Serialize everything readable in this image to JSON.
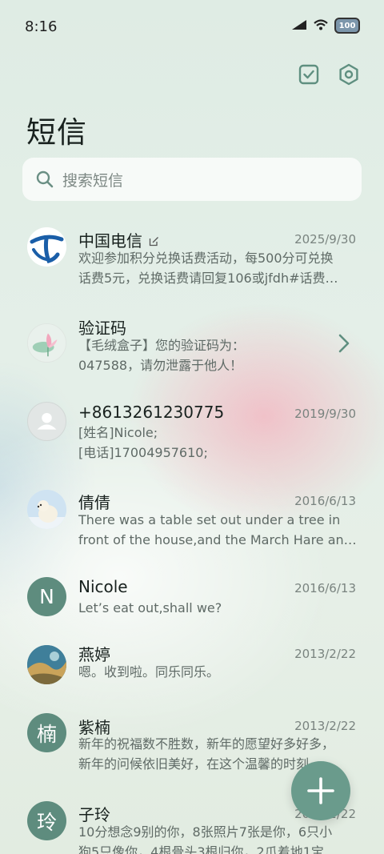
{
  "status_bar": {
    "time": "8:16",
    "battery": "100"
  },
  "header": {
    "title": "短信"
  },
  "search": {
    "placeholder": "搜索短信"
  },
  "conversations": [
    {
      "name": "中国电信",
      "date": "2025/9/30",
      "line1": "欢迎参加积分兑换话费活动，每500分可兑换",
      "line2": "话费5元，兑换话费请回复106或jfdh#话费…"
    },
    {
      "name": "验证码",
      "date": "",
      "line1": "【毛绒盒子】您的验证码为：",
      "line2": "047588，请勿泄露于他人！"
    },
    {
      "name": "+8613261230775",
      "date": "2019/9/30",
      "line1": "[姓名]Nicole;",
      "line2": "[电话]17004957610;"
    },
    {
      "name": "倩倩",
      "date": "2016/6/13",
      "line1": "There was a table set out under a tree in",
      "line2": "front of the house,and the March Hare an…"
    },
    {
      "name": "Nicole",
      "date": "2016/6/13",
      "avatar_letter": "N",
      "line1": "Let’s eat out,shall we?",
      "line2": ""
    },
    {
      "name": "燕婷",
      "date": "2013/2/22",
      "line1": "嗯。收到啦。同乐同乐。",
      "line2": ""
    },
    {
      "name": "紫楠",
      "date": "2013/2/22",
      "avatar_letter": "楠",
      "line1": "新年的祝福数不胜数，新年的愿望好多好多，",
      "line2": "新年的问候依旧美好，在这个温馨的时刻…"
    },
    {
      "name": "子玲",
      "date": "2013/2/22",
      "avatar_letter": "玲",
      "line1": "10分想念9别的你，8张照片7张是你，6只小",
      "line2": "狗5只像你，4根骨头3根归你，2爪着地1宝"
    }
  ],
  "icons": {
    "batch_select": "checkbox-icon",
    "settings": "settings-hexagon-icon",
    "search": "search-icon",
    "compose": "plus-icon"
  },
  "colors": {
    "accent": "#5f8f80",
    "fab": "#6a9b8c",
    "avatar_green": "#5e8c7e"
  }
}
